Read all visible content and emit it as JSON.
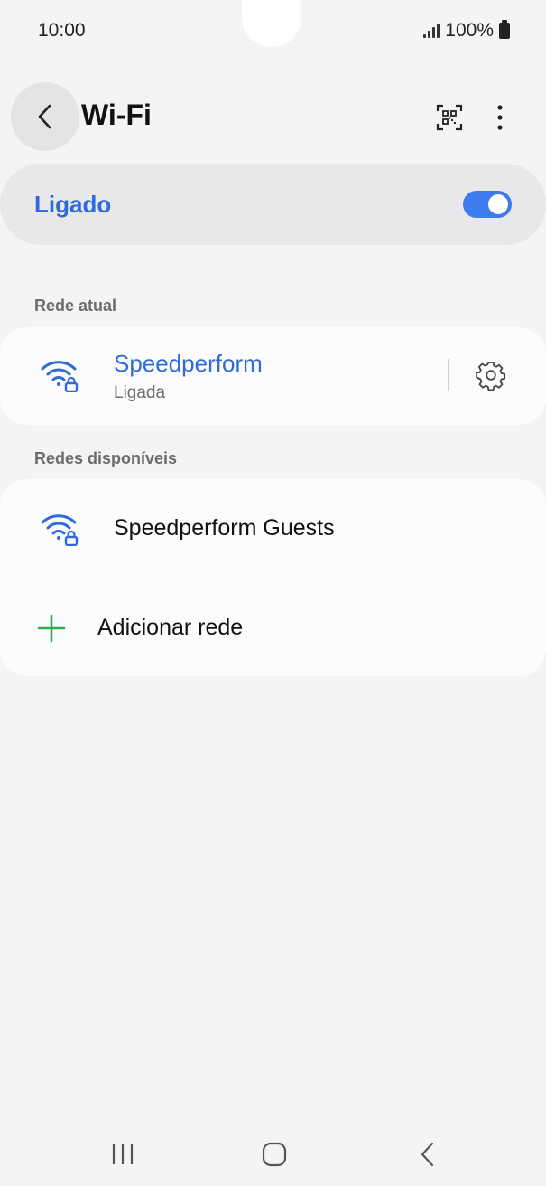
{
  "status_bar": {
    "time": "10:00",
    "battery": "100%"
  },
  "header": {
    "title": "Wi-Fi"
  },
  "master_switch": {
    "label": "Ligado",
    "on": true
  },
  "current_network": {
    "section_title": "Rede atual",
    "name": "Speedperform",
    "status": "Ligada"
  },
  "available_networks": {
    "section_title": "Redes disponíveis",
    "items": [
      {
        "name": "Speedperform Guests"
      }
    ],
    "add_label": "Adicionar rede"
  },
  "colors": {
    "accent": "#2e6bd9",
    "toggle": "#3e7bef",
    "add_icon": "#2bb04a",
    "background": "#f4f4f6"
  },
  "icons": [
    "back-icon",
    "qr-code-icon",
    "more-icon",
    "wifi-lock-icon",
    "settings-gear-icon",
    "plus-icon",
    "recent-apps-icon",
    "home-icon",
    "nav-back-icon"
  ]
}
